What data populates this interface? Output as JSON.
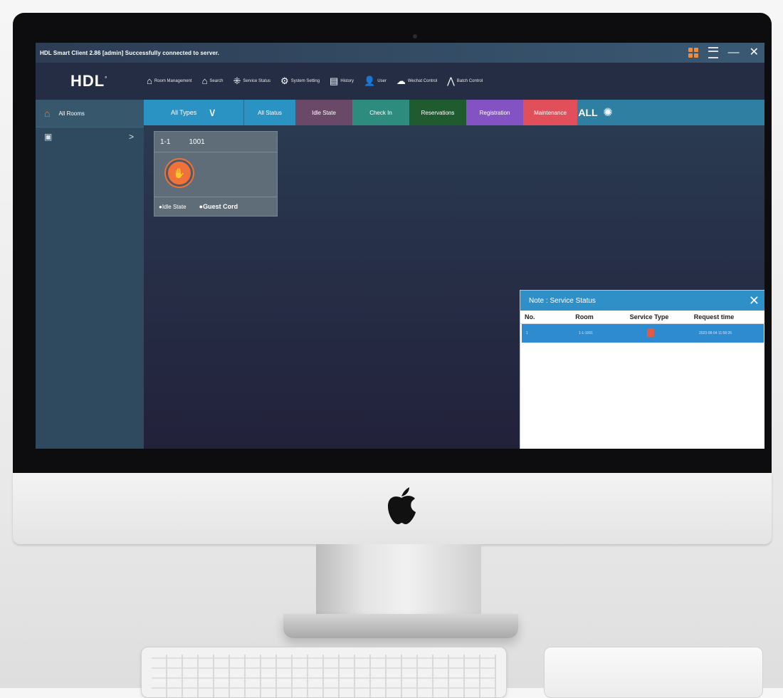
{
  "window": {
    "title": "HDL Smart Client 2.86  [admin]  Successfully connected to server."
  },
  "toolbar": {
    "brand": "HDL",
    "items": [
      {
        "label": "Room Management",
        "icon": "home-gear-icon"
      },
      {
        "label": "Search",
        "icon": "search-house-icon"
      },
      {
        "label": "Service Status",
        "icon": "grid-icon"
      },
      {
        "label": "System Setting",
        "icon": "gear-icon"
      },
      {
        "label": "History",
        "icon": "history-icon"
      },
      {
        "label": "User",
        "icon": "user-icon"
      },
      {
        "label": "Wechat Control",
        "icon": "wechat-icon"
      },
      {
        "label": "Batch Control",
        "icon": "batch-icon"
      }
    ]
  },
  "sidebar": {
    "header_label": "All Rooms",
    "row_arrow": ">"
  },
  "filters": {
    "types": "All Types",
    "all_status": "All Status",
    "idle": "Idle State",
    "check_in": "Check In",
    "reservations": "Reservations",
    "registration": "Registration",
    "maintenance": "Maintenance",
    "all": "ALL"
  },
  "room_card": {
    "floor": "1-1",
    "number": "1001",
    "status": "●Idle State",
    "card": "●Guest Cord"
  },
  "note": {
    "title": "Note : Service Status",
    "columns": {
      "no": "No.",
      "room": "Room",
      "service_type": "Service Type",
      "request_time": "Request time"
    },
    "rows": [
      {
        "no": "1",
        "room": "1-1-1001",
        "request_time": "2023-08-04 11:58:26"
      }
    ]
  },
  "colors": {
    "accent_orange": "#f07b3f",
    "filter_blue": "#2a93c4",
    "maintenance_red": "#e14f5a"
  }
}
